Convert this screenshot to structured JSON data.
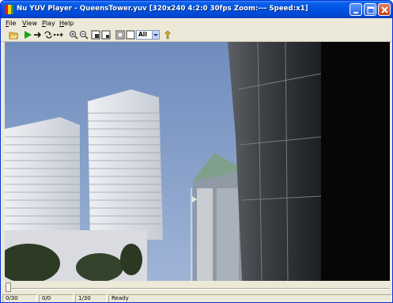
{
  "window": {
    "title": "Nu YUV Player - QueensTower.yuv [320x240 4:2:0 30fps Zoom:--- Speed:x1]"
  },
  "menu": {
    "items": [
      {
        "label": "File",
        "underline": "F",
        "rest": "ile"
      },
      {
        "label": "View",
        "underline": "V",
        "rest": "iew"
      },
      {
        "label": "Play",
        "underline": "P",
        "rest": "lay"
      },
      {
        "label": "Help",
        "underline": "H",
        "rest": "elp"
      }
    ]
  },
  "toolbar": {
    "icons": [
      "open-file-icon",
      "play-icon",
      "step-forward-icon",
      "loop-icon",
      "frame-skip-icon",
      "zoom-in-icon",
      "zoom-out-icon",
      "view-box-icon-1",
      "view-box-icon-2",
      "fit-window-icon",
      "fullscreen-icon",
      "about-icon"
    ],
    "component_select_value": "All"
  },
  "video": {
    "description_icon": "video-frame"
  },
  "status": {
    "frame": "0/30",
    "position": "0/0",
    "progress": "1/30",
    "state": "Ready"
  },
  "colors": {
    "titlebar": "#0055e5",
    "sky": "#7d98c2"
  }
}
